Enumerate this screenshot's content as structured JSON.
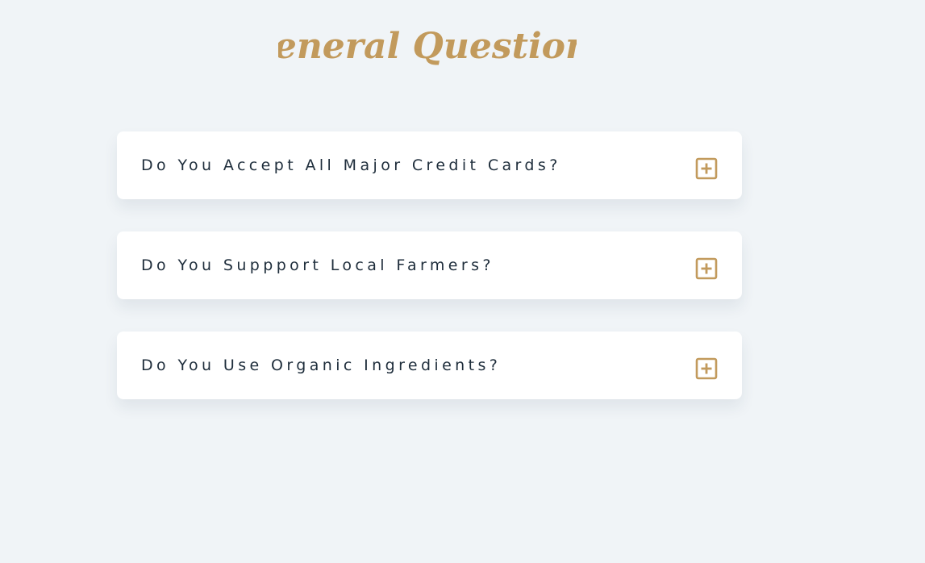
{
  "page": {
    "heading": "General Questions"
  },
  "faq": {
    "items": [
      {
        "question": "Do You Accept All Major Credit Cards?",
        "icon": "plus-square-icon"
      },
      {
        "question": "Do You Suppport Local Farmers?",
        "icon": "plus-square-icon"
      },
      {
        "question": "Do You Use Organic Ingredients?",
        "icon": "plus-square-icon"
      }
    ]
  },
  "colors": {
    "background": "#f0f4f7",
    "accent": "#c29a5c",
    "text": "#1e2d3b",
    "card": "#ffffff"
  }
}
